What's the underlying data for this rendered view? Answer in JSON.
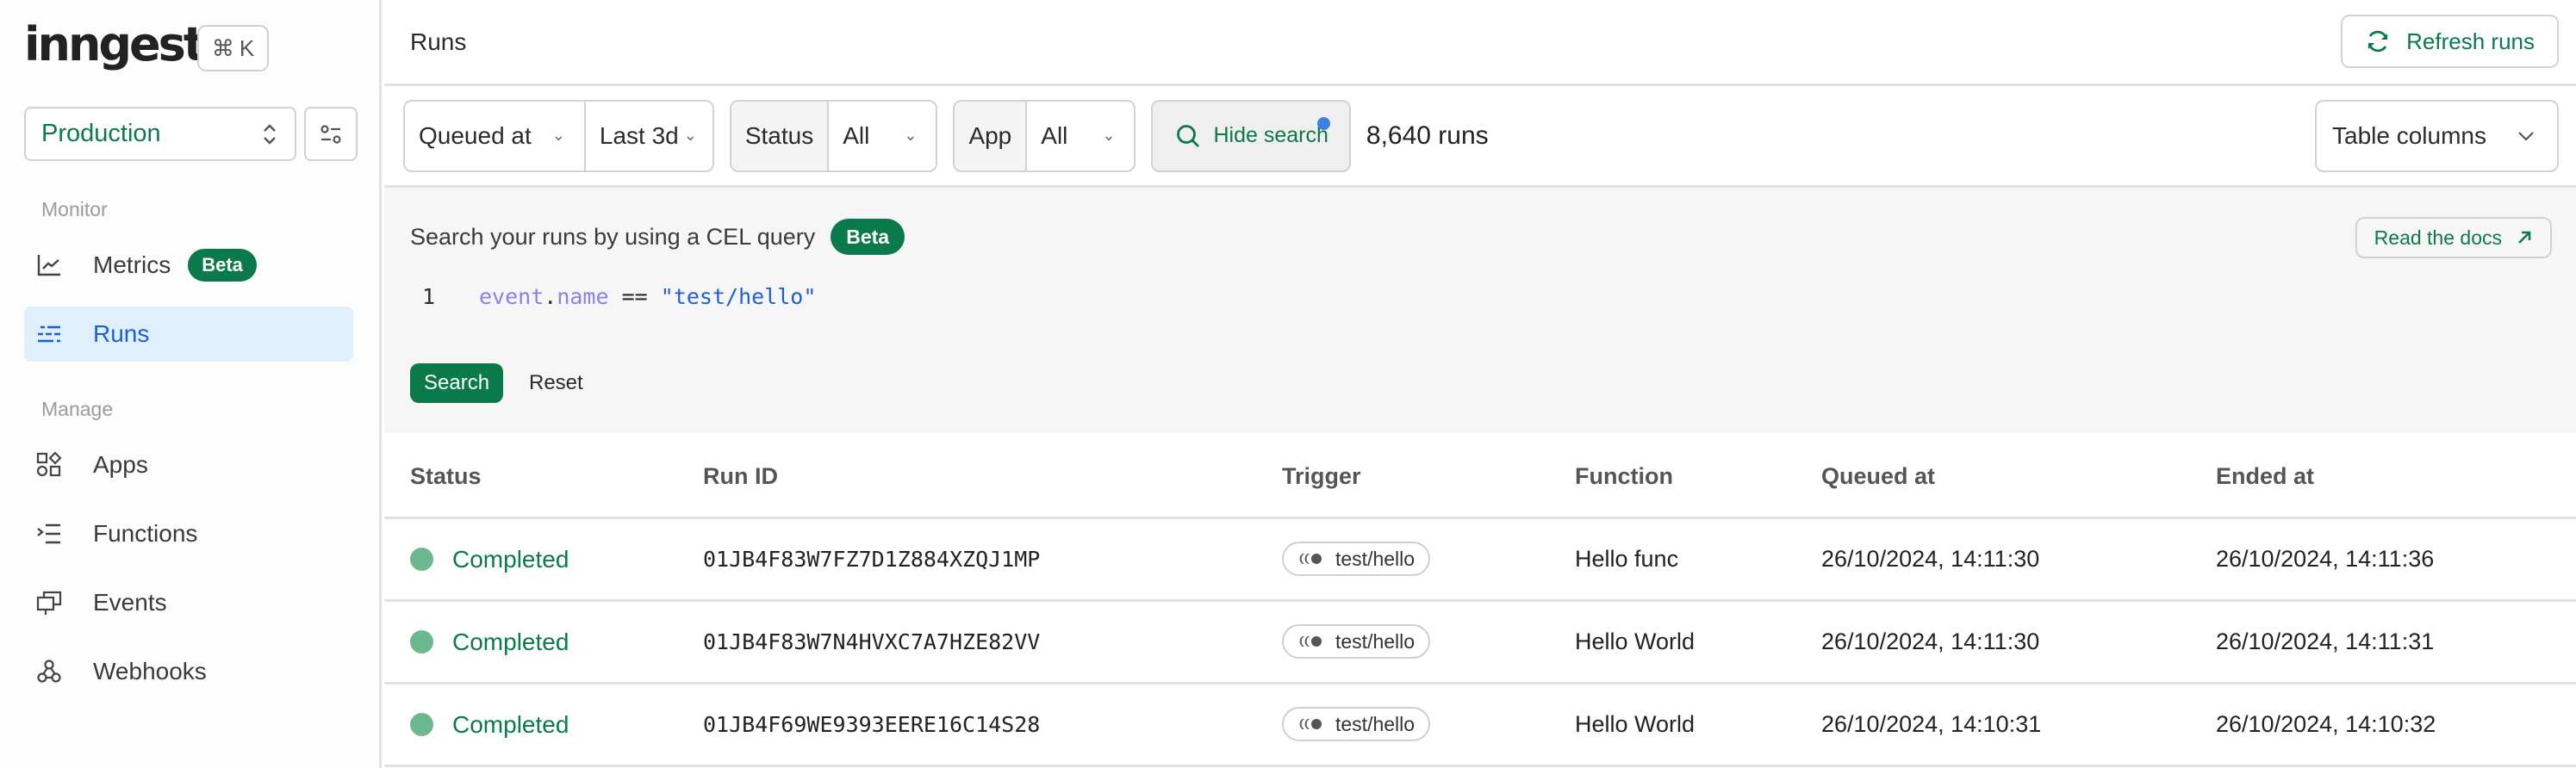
{
  "sidebar": {
    "logo": "inngest",
    "shortcut": {
      "symbol": "⌘",
      "key": "K"
    },
    "environment": "Production",
    "sections": [
      {
        "label": "Monitor"
      },
      {
        "label": "Manage"
      }
    ],
    "items": [
      {
        "label": "Metrics",
        "icon": "chart-line-icon",
        "badge": "Beta",
        "active": false
      },
      {
        "label": "Runs",
        "icon": "runs-list-icon",
        "active": true
      },
      {
        "label": "Apps",
        "icon": "apps-grid-icon",
        "active": false
      },
      {
        "label": "Functions",
        "icon": "functions-list-icon",
        "active": false
      },
      {
        "label": "Events",
        "icon": "events-icon",
        "active": false
      },
      {
        "label": "Webhooks",
        "icon": "webhook-icon",
        "active": false
      }
    ]
  },
  "header": {
    "title": "Runs",
    "refresh_label": "Refresh runs"
  },
  "filters": {
    "time_field": "Queued at",
    "time_range": "Last 3d",
    "status_label": "Status",
    "status_value": "All",
    "app_label": "App",
    "app_value": "All",
    "hide_search_label": "Hide search",
    "run_count": "8,640 runs",
    "table_columns_label": "Table columns"
  },
  "search": {
    "title": "Search your runs by using a CEL query",
    "badge": "Beta",
    "docs_label": "Read the docs",
    "query": {
      "line_number": "1",
      "ident1": "event",
      "dot": ".",
      "ident2": "name",
      "op": " == ",
      "string": "\"test/hello\""
    },
    "search_button": "Search",
    "reset_button": "Reset"
  },
  "table": {
    "columns": [
      "Status",
      "Run ID",
      "Trigger",
      "Function",
      "Queued at",
      "Ended at"
    ],
    "rows": [
      {
        "status": "Completed",
        "run_id": "01JB4F83W7FZ7D1Z884XZQJ1MP",
        "trigger": "test/hello",
        "function": "Hello func",
        "queued_at": "26/10/2024, 14:11:30",
        "ended_at": "26/10/2024, 14:11:36"
      },
      {
        "status": "Completed",
        "run_id": "01JB4F83W7N4HVXC7A7HZE82VV",
        "trigger": "test/hello",
        "function": "Hello World",
        "queued_at": "26/10/2024, 14:11:30",
        "ended_at": "26/10/2024, 14:11:31"
      },
      {
        "status": "Completed",
        "run_id": "01JB4F69WE9393EERE16C14S28",
        "trigger": "test/hello",
        "function": "Hello World",
        "queued_at": "26/10/2024, 14:10:31",
        "ended_at": "26/10/2024, 14:10:32"
      }
    ]
  },
  "colors": {
    "brand_green": "#0b7a4a",
    "status_completed": "#6bb78e",
    "active_nav_bg": "#dfeffc",
    "active_nav_text": "#1e5fd6",
    "notification_dot": "#3d7fe6"
  }
}
